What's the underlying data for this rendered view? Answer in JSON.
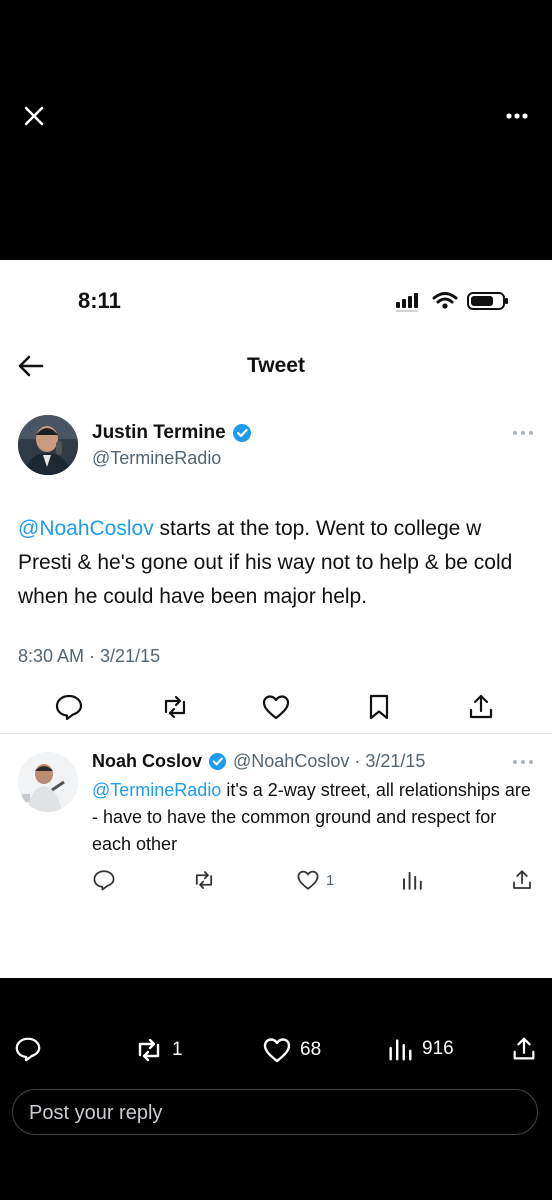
{
  "status_bar": {
    "time": "8:11"
  },
  "header": {
    "title": "Tweet"
  },
  "tweet": {
    "author_name": "Justin Termine",
    "handle": "@TermineRadio",
    "mention": "@NoahCoslov",
    "text": " starts at the top. Went to college w Presti & he's gone out if his way not to help & be cold when he could have been major help.",
    "timestamp": "8:30 AM · 3/21/15"
  },
  "reply": {
    "author_name": "Noah Coslov",
    "handle_date": "@NoahCoslov · 3/21/15",
    "mention": "@TermineRadio",
    "text": " it's a 2-way street, all relationships are - have to have the common ground and respect for each other",
    "likes": "1"
  },
  "bottom_actions": {
    "retweets": "1",
    "likes": "68",
    "views": "916"
  },
  "reply_box": {
    "placeholder": "Post your reply"
  },
  "colors": {
    "accent": "#1d9bf0",
    "secondary_text": "#536471"
  },
  "icons": [
    "close-icon",
    "more-icon",
    "back-arrow-icon",
    "verified-icon",
    "reply-icon",
    "retweet-icon",
    "like-icon",
    "bookmark-icon",
    "share-icon",
    "views-icon",
    "signal-icon",
    "wifi-icon",
    "battery-icon"
  ]
}
